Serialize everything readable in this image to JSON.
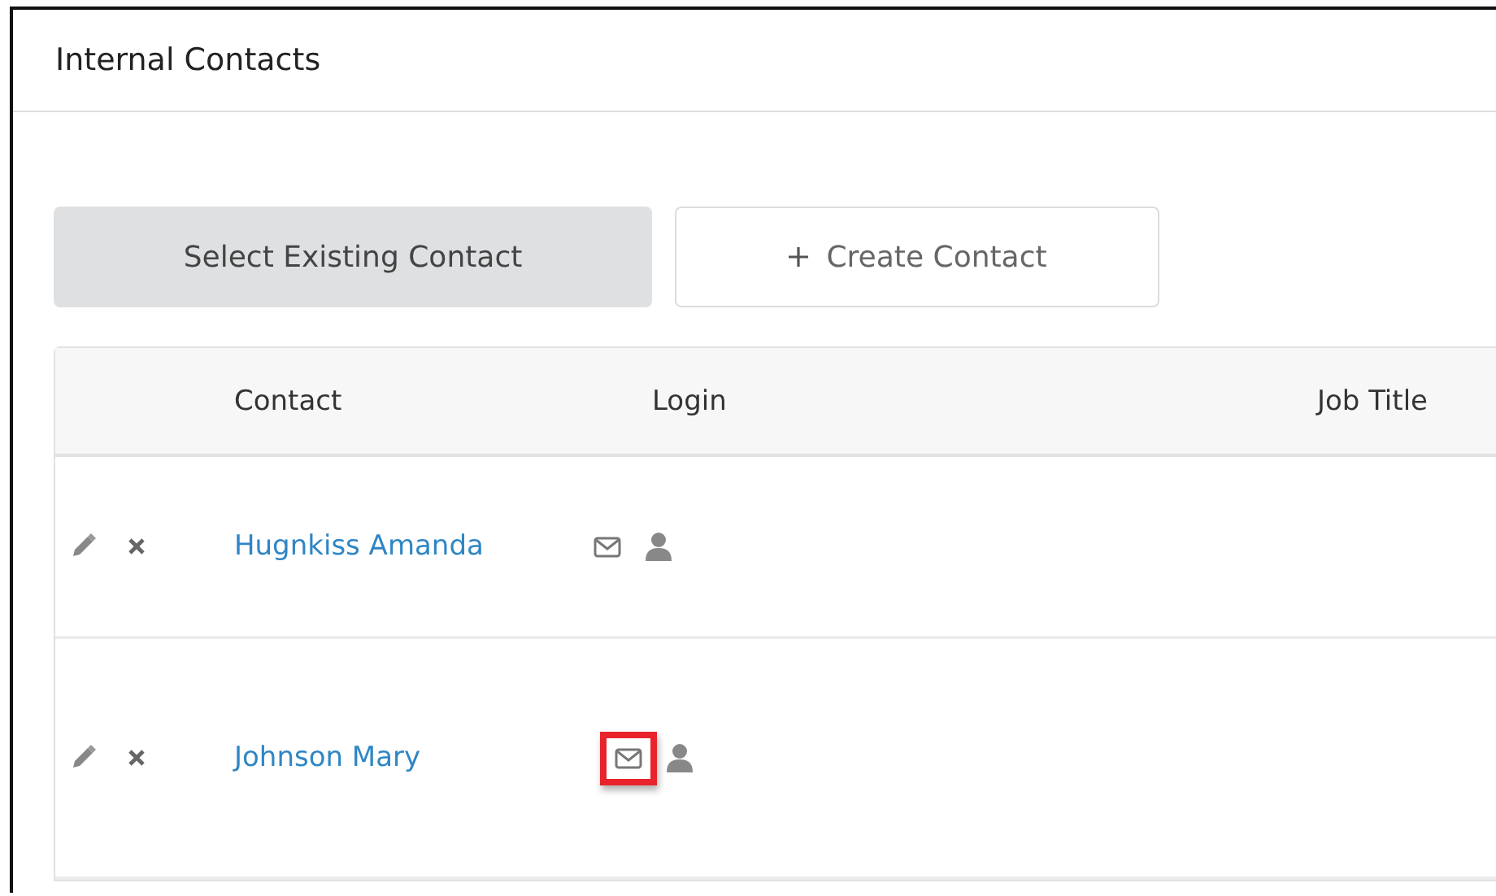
{
  "panel": {
    "title": "Internal Contacts"
  },
  "buttons": [
    {
      "label": "Select Existing Contact",
      "selected": true,
      "kind": "plain"
    },
    {
      "label": "Create Contact",
      "selected": false,
      "kind": "add"
    }
  ],
  "table": {
    "columns": [
      "Contact",
      "Login",
      "Job Title"
    ],
    "rows": [
      {
        "contact": "Hugnkiss Amanda",
        "email_highlighted": false
      },
      {
        "contact": "Johnson Mary",
        "email_highlighted": true
      }
    ]
  }
}
